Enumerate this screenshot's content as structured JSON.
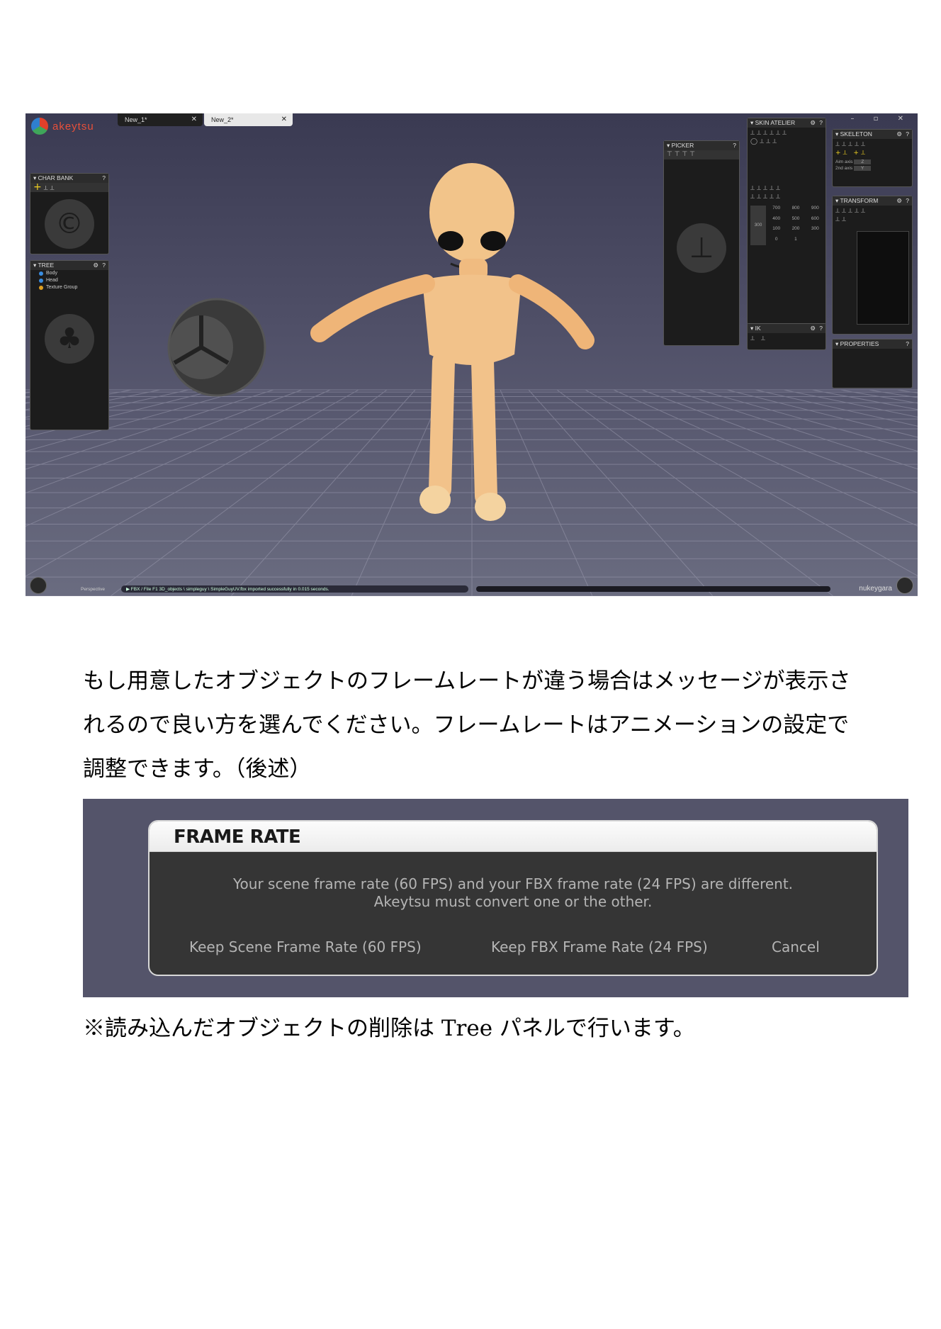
{
  "app": {
    "logo": "akeytsu",
    "tabs": [
      {
        "label": "New_1*",
        "close": "✕"
      },
      {
        "label": "New_2*",
        "close": "✕"
      }
    ],
    "panels": {
      "char_bank": "CHAR BANK",
      "tree": "TREE",
      "picker": "PICKER",
      "skin_atelier": "SKIN ATELIER",
      "ik": "IK",
      "skeleton": "SKELETON",
      "transform": "TRANSFORM",
      "properties": "PROPERTIES"
    },
    "help_glyph": "?",
    "gear_glyph": "⚙",
    "tree_items": [
      "Body",
      "Head",
      "Texture Group"
    ],
    "skeleton_fields": [
      {
        "label": "Aim axis",
        "value": "Z"
      },
      {
        "label": "2nd axis",
        "value": "Y"
      }
    ],
    "skin_values": [
      "700",
      "800",
      "900",
      "400",
      "500",
      "600",
      "100",
      "200",
      "300",
      "0",
      "1"
    ],
    "skin_main_value": "300",
    "viewport_label": "Perspective",
    "status_message": "▶  FBX / File F1  3D_objects \\ simpleguy \\ SimpleGuyUV.fbx imported successfully in 0.015 seconds.",
    "brand": "nukeygara",
    "window_controls": "– ▫ ✕"
  },
  "paragraph": [
    "もし用意したオブジェクトのフレームレートが違う場合はメッセージが表示さ",
    "れるので良い方を選んでください。フレームレートはアニメーションの設定で",
    "調整できます。（後述）"
  ],
  "dialog": {
    "title": "FRAME RATE",
    "message_line1": "Your scene frame rate (60 FPS) and your FBX frame rate (24 FPS) are different.",
    "message_line2": "Akeytsu must convert one or the other.",
    "keep_scene": "Keep Scene Frame Rate (60 FPS)",
    "keep_fbx": "Keep FBX Frame Rate (24 FPS)",
    "cancel": "Cancel"
  },
  "note": "※読み込んだオブジェクトの削除は Tree パネルで行います。",
  "colors": {
    "logo_accent": "#e8503a",
    "dialog_bg": "#353535",
    "dialog_text": "#b4b4b4"
  }
}
